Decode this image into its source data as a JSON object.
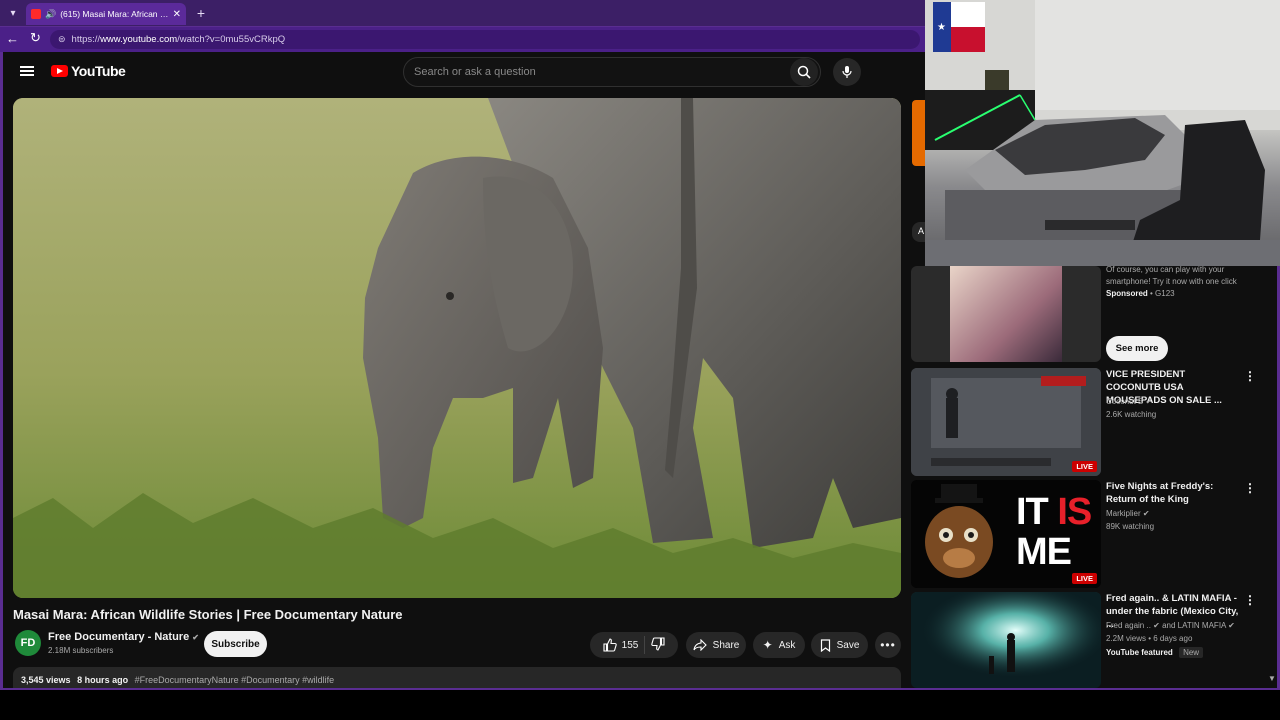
{
  "browser": {
    "tab_title": "(615) Masai Mara: African Wil",
    "tab_close": "✕",
    "new_tab": "+",
    "url_prefix": "https://",
    "url_host": "www.youtube.com",
    "url_path": "/watch?v=0mu55vCRkpQ"
  },
  "youtube": {
    "logo_text": "YouTube",
    "search_placeholder": "Search or ask a question"
  },
  "video": {
    "title": "Masai Mara: African Wildlife Stories | Free Documentary Nature",
    "channel_name": "Free Documentary - Nature",
    "channel_verified": "✔",
    "subscribers": "2.18M subscribers",
    "subscribe_label": "Subscribe",
    "likes": "155",
    "share_label": "Share",
    "ask_label": "Ask",
    "save_label": "Save",
    "views": "3,545 views",
    "age": "8 hours ago",
    "tags": "#FreeDocumentaryNature #Documentary #wildlife"
  },
  "sidebar": {
    "ad": {
      "description": "Of course, you can play with your smartphone! Try it now with one click",
      "sponsored": "Sponsored",
      "advertiser": " • G123",
      "see_more": "See more"
    },
    "items": [
      {
        "title": "VICE PRESIDENT COCONUTB USA MOUSEPADS ON SALE ...",
        "channel": "Coconut B",
        "stats": "2.6K watching",
        "badge": "LIVE"
      },
      {
        "title": "Five Nights at Freddy's: Return of the King",
        "channel": "Markiplier",
        "stats": "89K watching",
        "badge": "LIVE",
        "thumb_text_1": "IT ",
        "thumb_text_red": "IS",
        "thumb_text_2": "ME"
      },
      {
        "title": "Fred again.. & LATIN MAFIA - under the fabric (Mexico City, ...",
        "channel": "Fred again .. ✔ and LATIN MAFIA ✔",
        "stats": "2.2M views • 6 days ago",
        "featured": "YouTube featured",
        "new_badge": "New"
      }
    ]
  },
  "colors": {
    "browser_frame": "#3c1f66",
    "youtube_bg": "#0f0f0f",
    "accent_red": "#ff0000"
  }
}
